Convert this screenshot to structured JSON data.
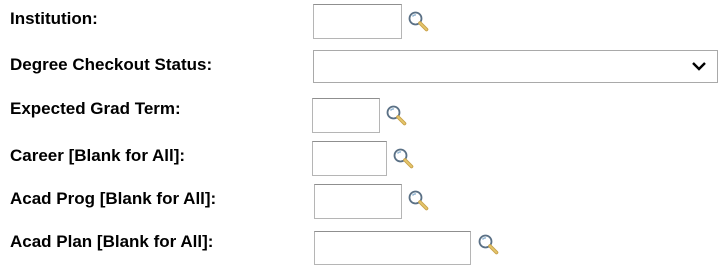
{
  "form": {
    "institution": {
      "label": "Institution:",
      "value": "",
      "icon": "lookup-magnifier-icon"
    },
    "degree_checkout_status": {
      "label": "Degree Checkout Status:",
      "selected": "",
      "icon": "chevron-down-icon"
    },
    "expected_grad_term": {
      "label": "Expected Grad Term:",
      "value": "",
      "icon": "lookup-magnifier-icon"
    },
    "career": {
      "label": "Career [Blank for All]:",
      "value": "",
      "icon": "lookup-magnifier-icon"
    },
    "acad_prog": {
      "label": "Acad Prog [Blank for All]:",
      "value": "",
      "icon": "lookup-magnifier-icon"
    },
    "acad_plan": {
      "label": "Acad Plan [Blank for All]:",
      "value": "",
      "icon": "lookup-magnifier-icon"
    }
  }
}
